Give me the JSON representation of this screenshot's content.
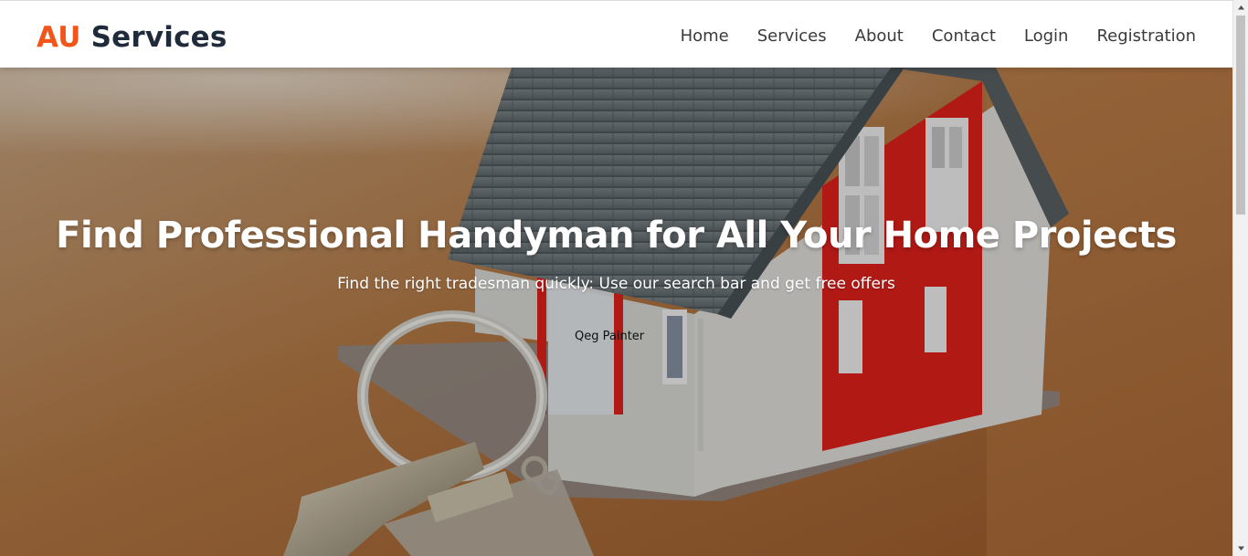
{
  "brand": {
    "part1": "AU",
    "part2": "Services"
  },
  "nav": {
    "items": [
      {
        "label": "Home"
      },
      {
        "label": "Services"
      },
      {
        "label": "About"
      },
      {
        "label": "Contact"
      },
      {
        "label": "Login"
      },
      {
        "label": "Registration"
      }
    ]
  },
  "hero": {
    "title": "Find Professional Handyman for All Your Home Projects",
    "subtitle": "Find the right tradesman quickly: Use our search bar and get free offers",
    "search_value": "Qeg Painter"
  },
  "colors": {
    "brand_accent": "#f2551a",
    "brand_dark": "#1f2b3a",
    "house_red": "#e3201b",
    "roof_gray": "#6b7378"
  }
}
